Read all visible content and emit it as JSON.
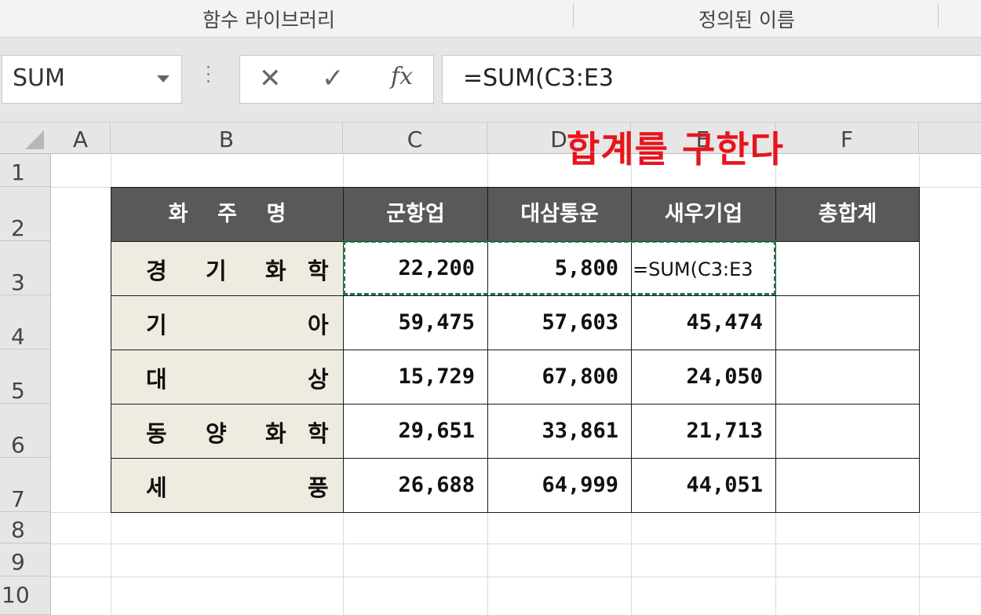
{
  "ribbon": {
    "group_left": "함수 라이브러리",
    "group_right": "정의된 이름"
  },
  "name_box": {
    "value": "SUM"
  },
  "formula_bar": {
    "cancel_icon": "✕",
    "enter_icon": "✓",
    "fx_icon": "fx",
    "value": "=SUM(C3:E3"
  },
  "columns": [
    "A",
    "B",
    "C",
    "D",
    "E",
    "F"
  ],
  "rows": [
    "1",
    "2",
    "3",
    "4",
    "5",
    "6",
    "7",
    "8",
    "9",
    "10"
  ],
  "table": {
    "headers": [
      "화    주    명",
      "군항업",
      "대삼통운",
      "새우기업",
      "총합계"
    ],
    "rows": [
      {
        "name": [
          "경",
          "기",
          "화",
          "학"
        ],
        "values": [
          "22,200",
          "5,800",
          ""
        ]
      },
      {
        "name": [
          "기",
          "아"
        ],
        "values": [
          "59,475",
          "57,603",
          "45,474"
        ]
      },
      {
        "name": [
          "대",
          "상"
        ],
        "values": [
          "15,729",
          "67,800",
          "24,050"
        ]
      },
      {
        "name": [
          "동",
          "양",
          "화",
          "학"
        ],
        "values": [
          "29,651",
          "33,861",
          "21,713"
        ]
      },
      {
        "name": [
          "세",
          "풍"
        ],
        "values": [
          "26,688",
          "64,999",
          "44,051"
        ]
      }
    ],
    "editing_formula": "=SUM(C3:E3"
  },
  "annotation": "합계를 구한다",
  "colors": {
    "header_bg": "#595959",
    "name_bg": "#eeece1",
    "marquee": "#217346",
    "annotation": "#e8141c"
  }
}
